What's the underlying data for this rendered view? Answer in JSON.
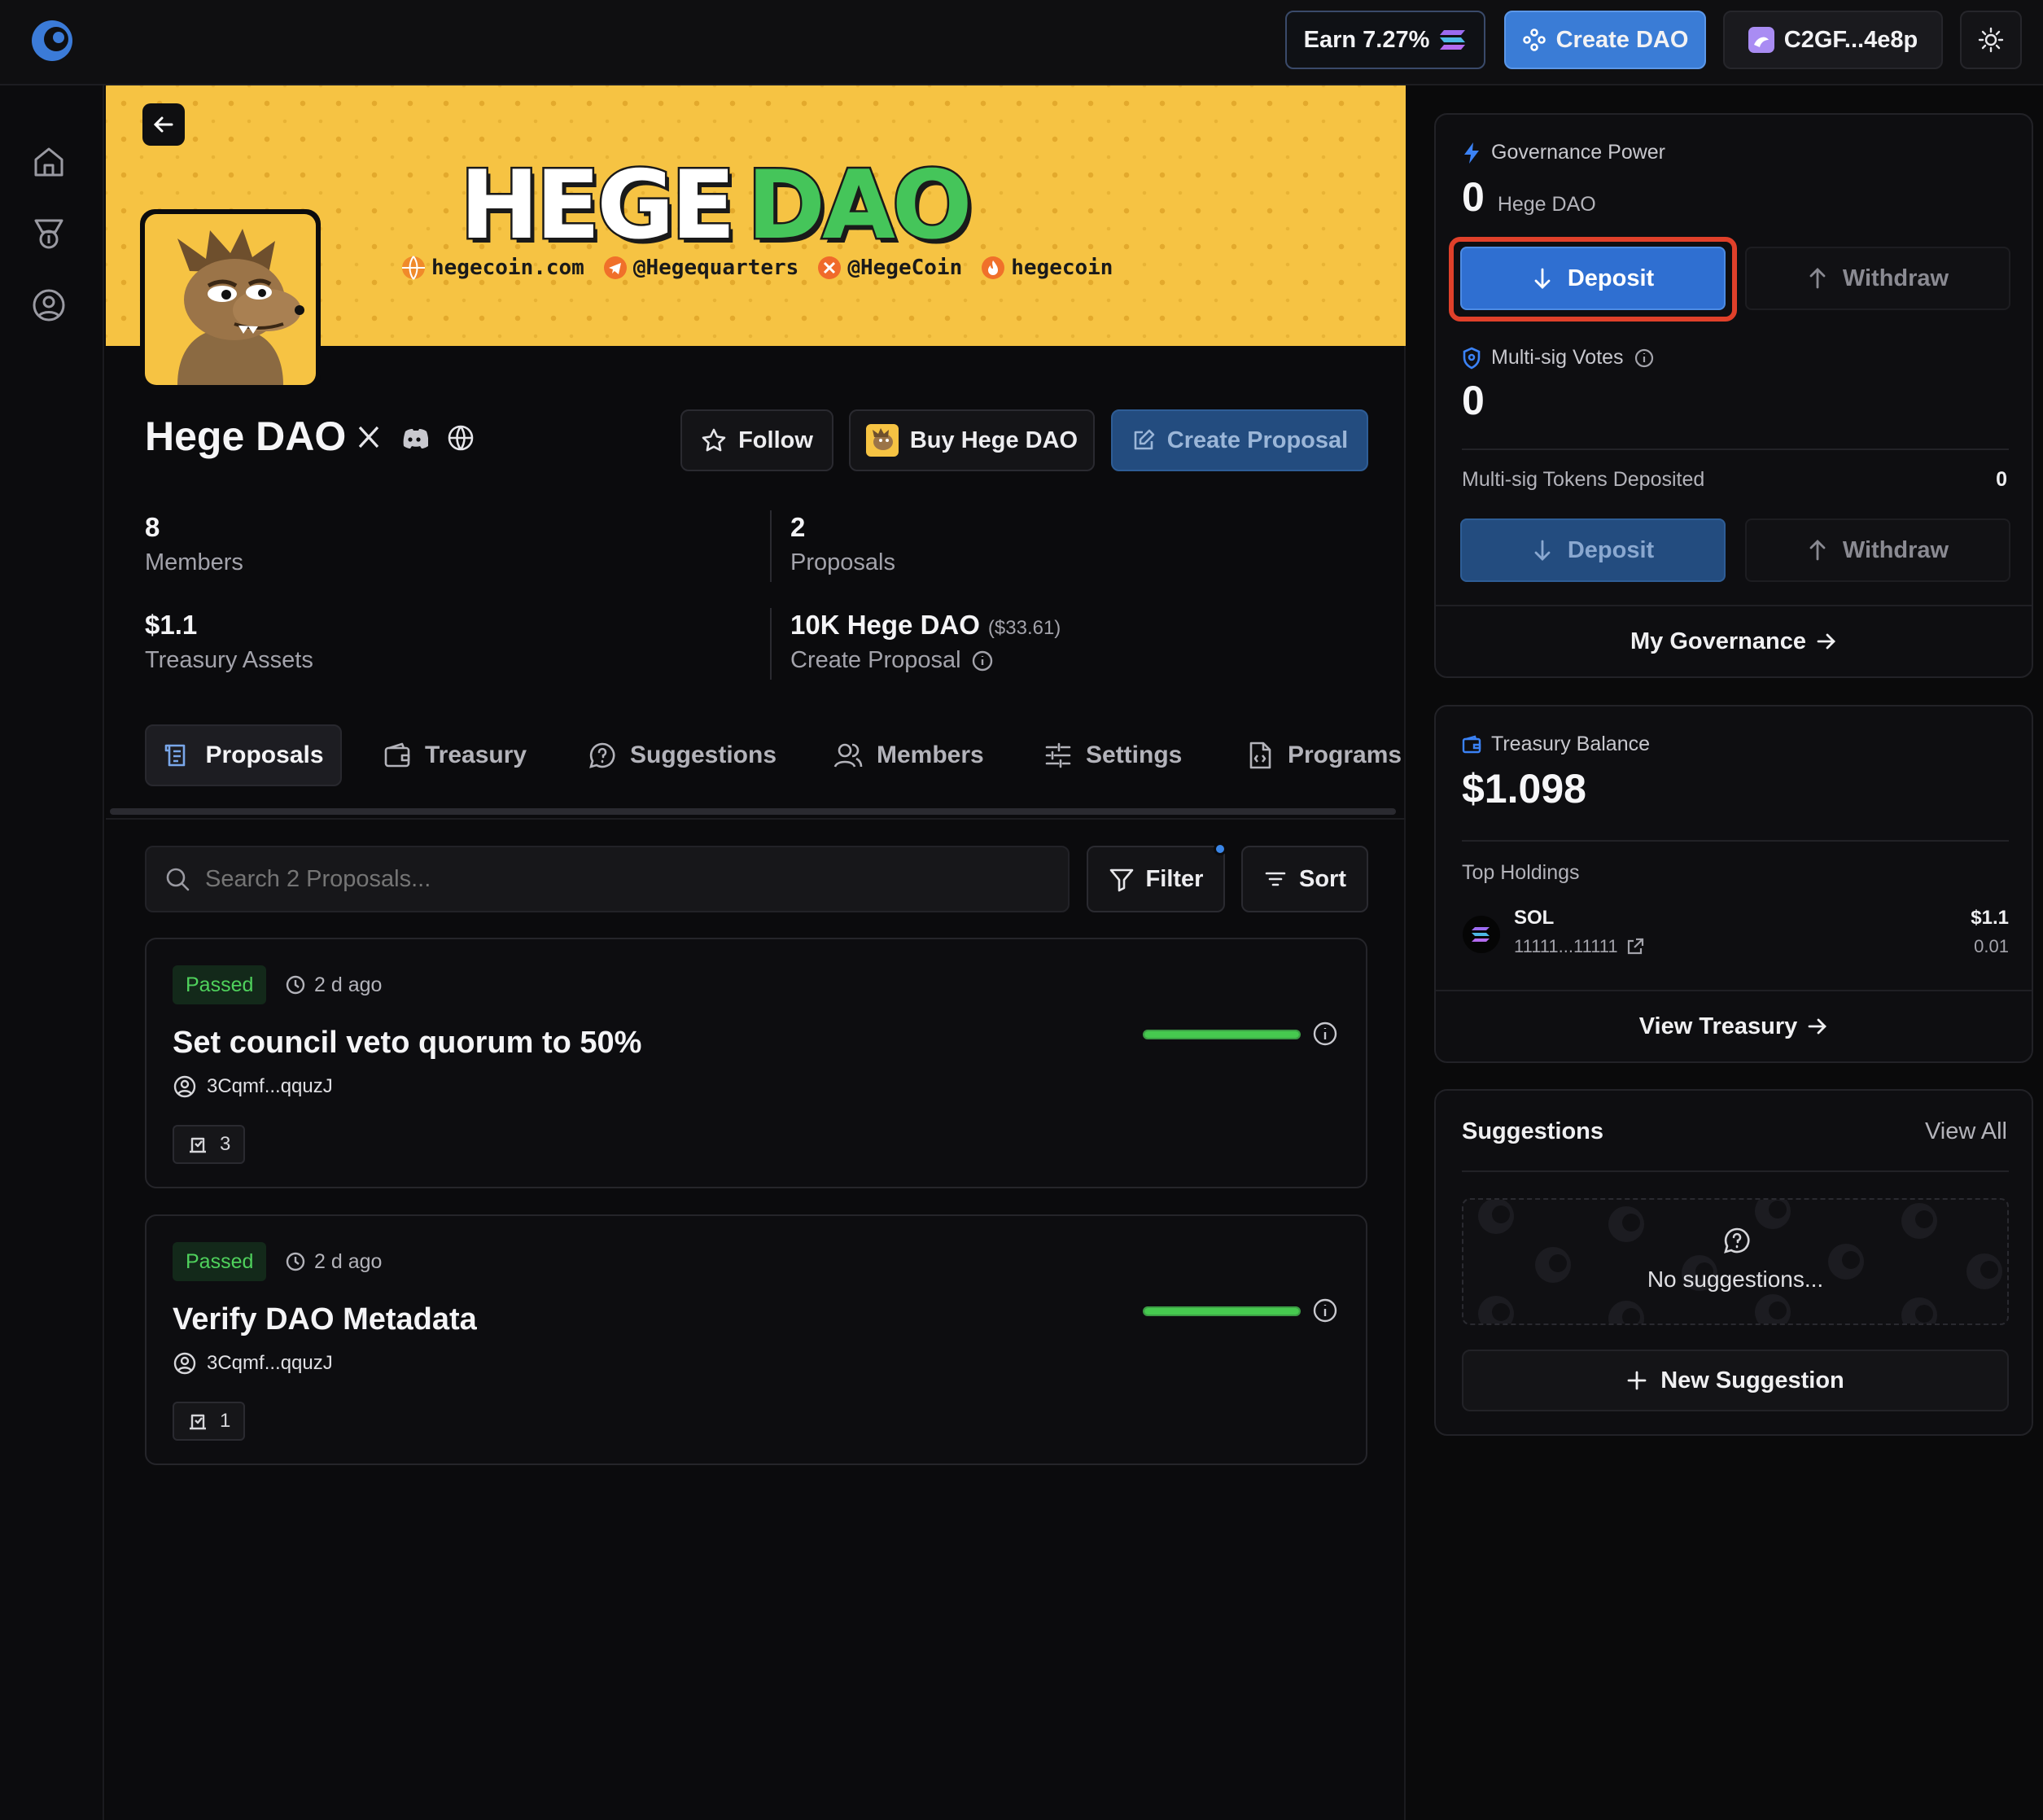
{
  "topbar": {
    "earn_label": "Earn 7.27%",
    "create_dao_label": "Create DAO",
    "wallet_label": "C2GF...4e8p"
  },
  "sidebar": {
    "items": [
      {
        "icon": "home-icon"
      },
      {
        "icon": "medal-icon"
      },
      {
        "icon": "user-circle-icon"
      }
    ]
  },
  "banner": {
    "title_part1": "HEGE",
    "title_part2": "DAO",
    "links": [
      "hegecoin.com",
      "@Hegequarters",
      "@HegeCoin",
      "hegecoin"
    ]
  },
  "dao": {
    "name": "Hege DAO",
    "follow_label": "Follow",
    "buy_label": "Buy Hege DAO",
    "create_proposal_label": "Create Proposal"
  },
  "stats": {
    "members_value": "8",
    "members_label": "Members",
    "proposals_value": "2",
    "proposals_label": "Proposals",
    "treasury_value": "$1.1",
    "treasury_label": "Treasury Assets",
    "threshold_value": "10K Hege DAO",
    "threshold_usd": "($33.61)",
    "threshold_label": "Create Proposal"
  },
  "tabs": [
    "Proposals",
    "Treasury",
    "Suggestions",
    "Members",
    "Settings",
    "Programs"
  ],
  "search": {
    "placeholder": "Search 2 Proposals...",
    "filter_label": "Filter",
    "sort_label": "Sort"
  },
  "proposals": [
    {
      "status": "Passed",
      "time": "2 d ago",
      "title": "Set council veto quorum to 50%",
      "author": "3Cqmf...qquzJ",
      "count": "3",
      "progress": 1.0
    },
    {
      "status": "Passed",
      "time": "2 d ago",
      "title": "Verify DAO Metadata",
      "author": "3Cqmf...qquzJ",
      "count": "1",
      "progress": 1.0
    }
  ],
  "governance": {
    "title": "Governance Power",
    "value": "0",
    "token": "Hege DAO",
    "deposit_label": "Deposit",
    "withdraw_label": "Withdraw",
    "multisig_title": "Multi-sig Votes",
    "multisig_value": "0",
    "multisig_tokens_label": "Multi-sig Tokens Deposited",
    "multisig_tokens_value": "0",
    "link_label": "My Governance"
  },
  "treasury": {
    "title": "Treasury Balance",
    "value": "$1.098",
    "holdings_title": "Top Holdings",
    "holding": {
      "symbol": "SOL",
      "address": "11111...11111",
      "usd": "$1.1",
      "amount": "0.01"
    },
    "link_label": "View Treasury"
  },
  "suggestions": {
    "title": "Suggestions",
    "view_all_label": "View All",
    "empty_label": "No suggestions...",
    "new_label": "New Suggestion"
  },
  "colors": {
    "accent": "#2f6fd1",
    "banner": "#f6c343",
    "passed_green": "#46c94f",
    "highlight_red": "#e0402a"
  }
}
